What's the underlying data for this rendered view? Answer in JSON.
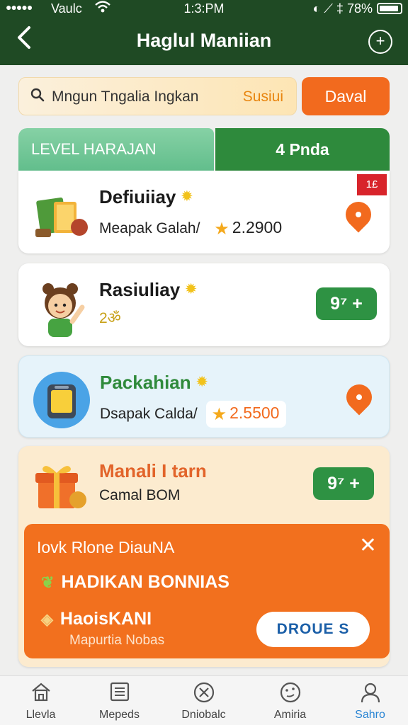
{
  "status_bar": {
    "signal": "●●●●●",
    "carrier": "Vaulc",
    "time": "1:3:PM",
    "right_icons": "◐ ⟋ ‡",
    "battery": "78%"
  },
  "header": {
    "title": "Haglul Maniian",
    "back_icon": "chevron-left-icon",
    "menu_icon": "plus-circle-icon"
  },
  "search": {
    "query": "Mngun Tngalia Ingkan",
    "suffix": "Susiui",
    "button": "Daval"
  },
  "tabs": {
    "left": "LEVEL HARAJAN",
    "right": "4 Pnda"
  },
  "items": [
    {
      "name": "Defiuiiay",
      "sub": "Meapak Galah/",
      "price": "2.2900",
      "tag": "1£"
    },
    {
      "name": "Rasiuliay",
      "sub": "2ॐ",
      "button": "9⁷ +"
    },
    {
      "name": "Packahian",
      "sub": "Dsapak Calda/",
      "price": "2.5500"
    },
    {
      "name": "Manali I tarn",
      "sub": "Camal  BOM",
      "button": "9⁷ +"
    }
  ],
  "promo": {
    "title": "Iovk Rlone DiauNA",
    "line1": "HADIKAN BONNIAS",
    "line2": "HaoisKANI",
    "line3": "Mapurtia Nobas",
    "button": "DROUE S"
  },
  "nav": [
    {
      "label": "Llevla",
      "icon": "home-icon"
    },
    {
      "label": "Mepeds",
      "icon": "list-icon"
    },
    {
      "label": "Dniobalc",
      "icon": "close-circle-icon"
    },
    {
      "label": "Amiria",
      "icon": "smiley-icon"
    },
    {
      "label": "Sahro",
      "icon": "user-icon",
      "active": true
    }
  ],
  "colors": {
    "header": "#1f4a24",
    "accent_orange": "#f26a1e",
    "accent_green": "#2e9243",
    "tab_light": "#62be8c",
    "active_nav": "#2a85d4"
  }
}
